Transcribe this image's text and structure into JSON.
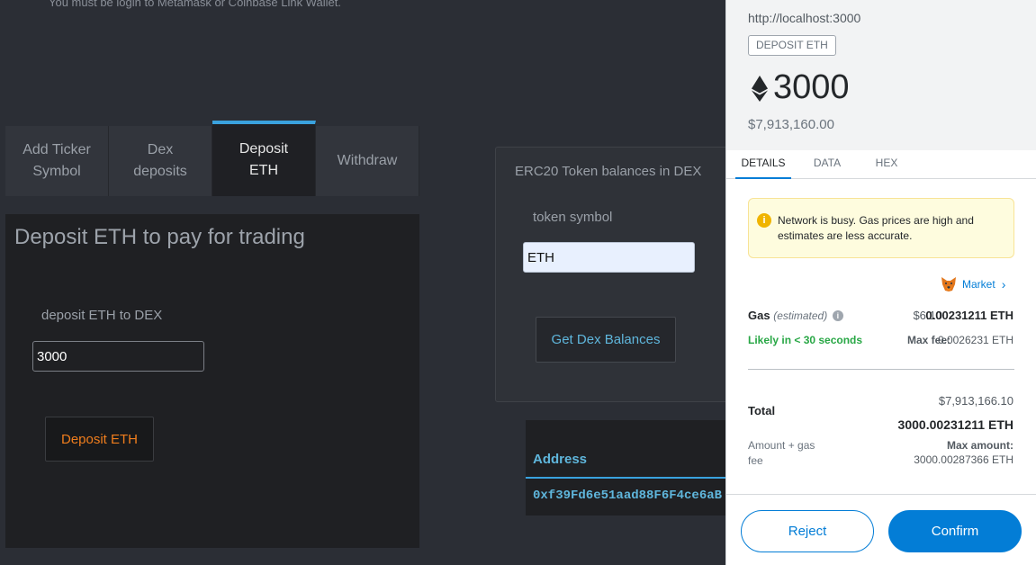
{
  "dex": {
    "login_note": "You must be login to Metamask or Coinbase Link Wallet.",
    "tabs": [
      {
        "label": "Add Ticker\nSymbol"
      },
      {
        "label": "Dex\ndeposits"
      },
      {
        "label": "Deposit\nETH",
        "active": true
      },
      {
        "label": "Withdraw"
      }
    ],
    "deposit": {
      "title": "Deposit ETH to pay for trading",
      "label": "deposit ETH to DEX",
      "input_value": "3000",
      "button": "Deposit ETH"
    },
    "erc20": {
      "title": "ERC20 Token balances in DEX",
      "label": "token symbol",
      "input_value": "ETH",
      "button": "Get Dex Balances"
    },
    "table": {
      "header": "Address",
      "address": "0xf39Fd6e51aad88F6F4ce6aB"
    }
  },
  "metamask": {
    "origin": "http://localhost:3000",
    "badge": "DEPOSIT ETH",
    "amount": "3000",
    "fiat": "$7,913,160.00",
    "tabs": [
      "DETAILS",
      "DATA",
      "HEX"
    ],
    "warning": "Network is busy. Gas prices are high and estimates are less accurate.",
    "market_label": "Market",
    "gas": {
      "label": "Gas",
      "estimated": "(estimated)",
      "fiat": "$6.10",
      "eth": "0.00231211 ETH",
      "likely": "Likely in < 30 seconds",
      "max_fee_label": "Max fee:",
      "max_fee": "0.0026231 ETH"
    },
    "total": {
      "label": "Total",
      "fiat": "$7,913,166.10",
      "eth": "3000.00231211 ETH",
      "amount_gas_label": "Amount + gas fee",
      "max_amount_label": "Max amount:",
      "max_amount": "3000.00287366 ETH"
    },
    "reject_label": "Reject",
    "confirm_label": "Confirm"
  }
}
